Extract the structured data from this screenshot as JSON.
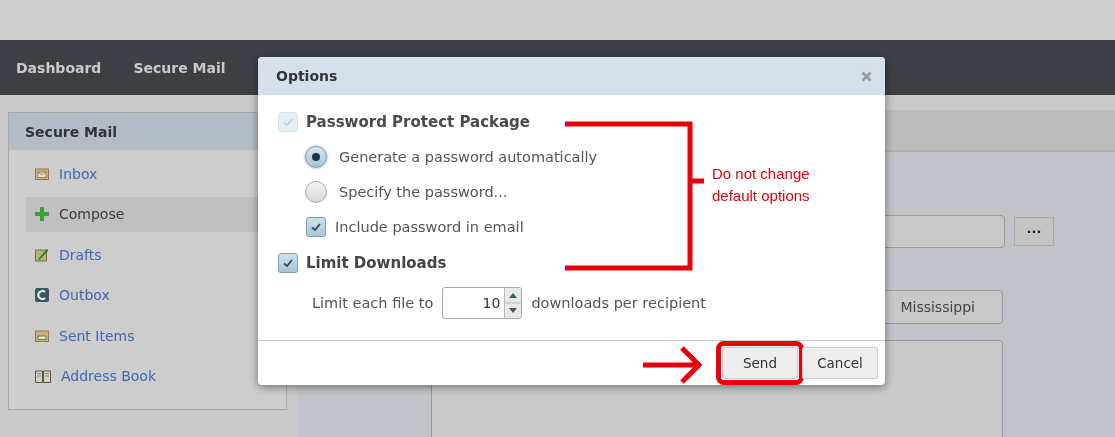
{
  "nav": {
    "items": [
      {
        "label": "Dashboard"
      },
      {
        "label": "Secure Mail"
      }
    ]
  },
  "sidebar": {
    "title": "Secure Mail",
    "items": [
      {
        "label": "Inbox",
        "selected": false
      },
      {
        "label": "Compose",
        "selected": true
      },
      {
        "label": "Drafts",
        "selected": false
      },
      {
        "label": "Outbox",
        "selected": false
      },
      {
        "label": "Sent Items",
        "selected": false
      },
      {
        "label": "Address Book",
        "selected": false
      }
    ]
  },
  "compose": {
    "browse_button": "...",
    "subject_value": "Mississippi"
  },
  "dialog": {
    "title": "Options",
    "password_protect": {
      "label": "Password Protect Package",
      "checked": true,
      "disabled": true
    },
    "password_modes": [
      {
        "label": "Generate a password automatically",
        "selected": true
      },
      {
        "label": "Specify the password...",
        "selected": false
      }
    ],
    "include_password": {
      "label": "Include password in email",
      "checked": true
    },
    "limit_downloads": {
      "label": "Limit Downloads",
      "checked": true
    },
    "limit_row": {
      "prefix": "Limit each file to",
      "value": "10",
      "suffix": "downloads per recipient"
    },
    "buttons": [
      {
        "label": "Send",
        "highlighted": true
      },
      {
        "label": "Cancel",
        "highlighted": false
      }
    ]
  },
  "annotation": {
    "text": "Do not change default options"
  }
}
